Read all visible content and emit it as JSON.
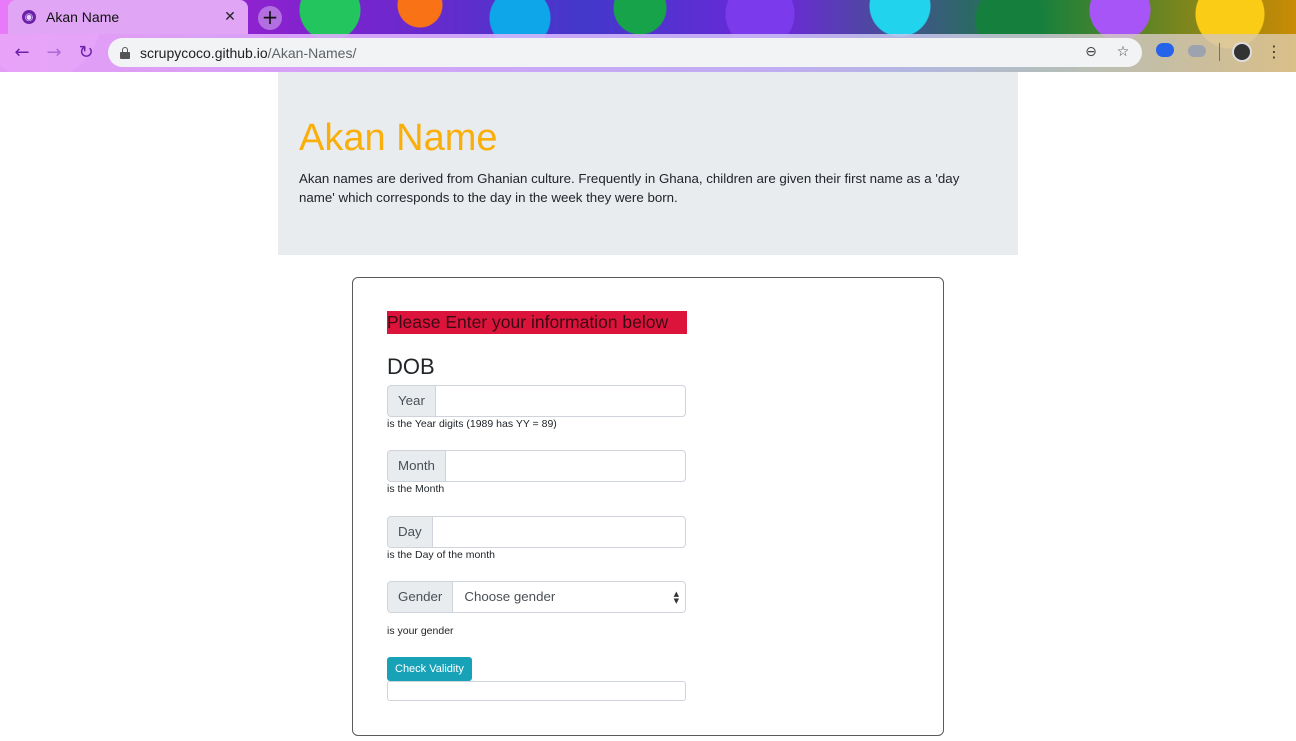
{
  "browser": {
    "tab_title": "Akan Name",
    "tab_close": "✕",
    "new_tab": "+",
    "url_host": "scrupycoco.github.io",
    "url_path": "/Akan-Names/",
    "icons": [
      "back-arrow-icon",
      "forward-arrow-icon",
      "reload-icon",
      "lock-icon",
      "zoom-out-icon",
      "star-icon",
      "cloud-extension-icon",
      "extension-icon",
      "profile-avatar-icon",
      "more-menu-icon"
    ]
  },
  "jumbotron": {
    "title": "Akan Name",
    "description": "Akan names are derived from Ghanian culture. Frequently in Ghana, children are given their first name as a 'day name' which corresponds to the day in the week they were born."
  },
  "form": {
    "banner": "Please Enter your information below",
    "section_title": "DOB",
    "fields": [
      {
        "label": "Year",
        "value": "",
        "help": "is the Year digits (1989 has YY = 89)"
      },
      {
        "label": "Month",
        "value": "",
        "help": "is the Month"
      },
      {
        "label": "Day",
        "value": "",
        "help": "is the Day of the month"
      }
    ],
    "gender": {
      "label": "Gender",
      "selected": "Choose gender",
      "help": "is your gender"
    },
    "submit_label": "Check Validity",
    "output_value": ""
  },
  "colors": {
    "title": "#f9ae0a",
    "banner": "#dc143c",
    "button": "#17a2b8",
    "jumbotron_bg": "#e9ecef"
  }
}
